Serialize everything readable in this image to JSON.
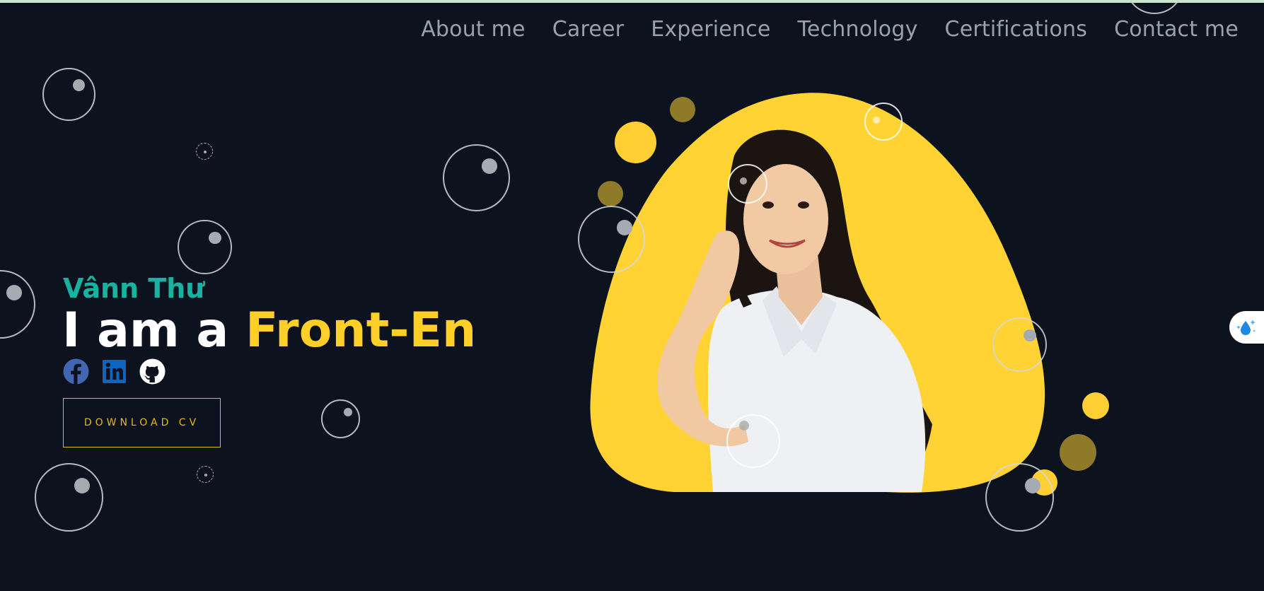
{
  "nav": {
    "items": [
      {
        "label": "About me"
      },
      {
        "label": "Career"
      },
      {
        "label": "Experience"
      },
      {
        "label": "Technology"
      },
      {
        "label": "Certifications"
      },
      {
        "label": "Contact me"
      }
    ]
  },
  "hero": {
    "name": "Vânn Thư",
    "title_prefix": "I am a ",
    "title_role": "Front-En",
    "download_label": "DOWNLOAD CV"
  },
  "socials": [
    {
      "icon": "facebook-icon"
    },
    {
      "icon": "linkedin-icon"
    },
    {
      "icon": "github-icon"
    }
  ],
  "colors": {
    "background": "#0c121e",
    "accent_yellow": "#ffcf29",
    "accent_teal": "#17b3a0",
    "nav_text": "#98a2ae",
    "facebook": "#4267b2",
    "linkedin": "#0a66c2"
  }
}
